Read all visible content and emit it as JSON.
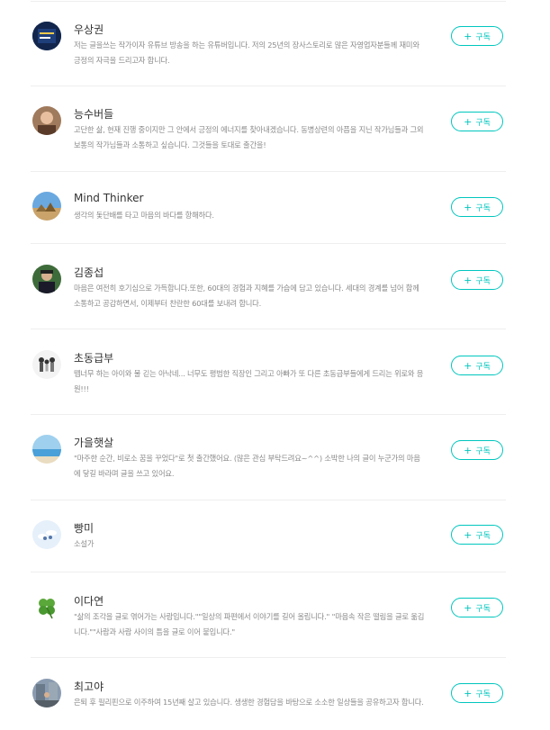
{
  "subscribe_label": "구독",
  "plus_icon": "+",
  "accent_color": "#00c6be",
  "authors": [
    {
      "name": "우상권",
      "desc": "저는 글을쓰는 작가이자 유튜브 방송을 하는 유튜버입니다. 저의 25년의 장사스토리로 많은 자영업자분들께 재미와 긍정의 자극을 드리고자 합니다.",
      "avatar": "book-cover-avatar"
    },
    {
      "name": "능수버들",
      "desc": "고단한 삶, 현재 진행 중이지만 그 안에서 긍정의 에너지를 찾아내겠습니다. 동병상련의 아픔을 지닌 작가님들과 그외 보통의 작가님들과 소통하고 싶습니다. 그것들을 토대로 출간을!",
      "avatar": "portrait-avatar"
    },
    {
      "name": "Mind Thinker",
      "desc": "생각의 돛단배를 타고 마음의 바다를 항해하다.",
      "avatar": "desert-avatar"
    },
    {
      "name": "김종섭",
      "desc": "마음은 여전히 호기심으로 가득합니다.또한, 60대의 경험과 지혜를 가슴에 담고 있습니다. 세대의 경계를 넘어 함께 소통하고 공감하면서, 이제부터 찬란한 60대를 보내려 합니다.",
      "avatar": "hiker-avatar"
    },
    {
      "name": "초동급부",
      "desc": "뗍너무 하는 아이와 물 긷는 아낙네... 너무도 평범한 직장인 그리고 아빠가 또 다른 초동급부들에게 드리는 위로와 응원!!!",
      "avatar": "family-avatar"
    },
    {
      "name": "가을햇살",
      "desc": "\"마주한 순간, 비로소 꿈을 꾸었다\"로 첫 출간했어요. (많은 관심 부탁드려요~^^) 소박한 나의 글이 누군가의 마음에 닿길 바라며 글을 쓰고 있어요.",
      "avatar": "sea-avatar"
    },
    {
      "name": "빵미",
      "desc": "소설가",
      "avatar": "sky-avatar"
    },
    {
      "name": "이다연",
      "desc": "\"삶의 조각을 글로 엮어가는 사람입니다.\"\"일상의 파편에서 이야기를 길어 올립니다.\" \"마음속 작은 떨림을 글로 옮깁니다.\"\"사람과 사람 사이의 틈을 글로 이어 붙입니다.\"",
      "avatar": "clover-avatar"
    },
    {
      "name": "최고야",
      "desc": "은퇴 후 필리핀으로 이주하여 15년째 살고 있습니다. 생생한 경험담을 바탕으로 소소한 일상들을 공유하고자 합니다.",
      "avatar": "street-avatar"
    }
  ]
}
